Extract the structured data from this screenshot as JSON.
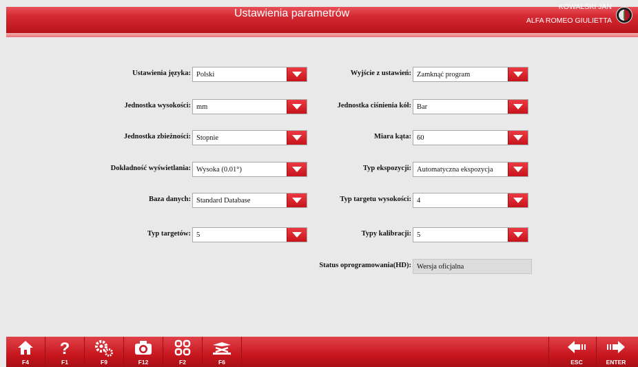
{
  "header": {
    "title": "Ustawienia parametrów",
    "user": "KOWALSKI JAN",
    "vehicle": "ALFA ROMEO GIULIETTA",
    "logo_icon": "alfa-romeo-logo-icon"
  },
  "left_settings": [
    {
      "label": "Ustawienia języka:",
      "value": "Polski"
    },
    {
      "label": "Jednostka wysokości:",
      "value": "mm"
    },
    {
      "label": "Jednostka zbieżności:",
      "value": "Stopnie"
    },
    {
      "label": "Dokładność wyświetlania:",
      "value": "Wysoka (0.01°)"
    },
    {
      "label": "Baza danych:",
      "value": "Standard Database"
    },
    {
      "label": "Typ targetów:",
      "value": "5"
    }
  ],
  "right_settings": [
    {
      "label": "Wyjście z ustawień:",
      "value": "Zamknąć program"
    },
    {
      "label": "Jednostka ciśnienia kół:",
      "value": "Bar"
    },
    {
      "label": "Miara kąta:",
      "value": "60"
    },
    {
      "label": "Typ ekspozycji:",
      "value": "Automatyczna ekspozycja"
    },
    {
      "label": "Typ targetu wysokości:",
      "value": "4"
    },
    {
      "label": "Typy kalibracji:",
      "value": "5"
    }
  ],
  "status": {
    "label": "Status oprogramowania(HD):",
    "value": "Wersja oficjalna"
  },
  "footer": {
    "keys": [
      {
        "label": "F4",
        "icon": "home-icon"
      },
      {
        "label": "F1",
        "icon": "help-icon"
      },
      {
        "label": "F9",
        "icon": "gears-icon"
      },
      {
        "label": "F12",
        "icon": "camera-icon"
      },
      {
        "label": "F2",
        "icon": "grid-icon"
      },
      {
        "label": "F6",
        "icon": "lift-icon"
      },
      {
        "label": "ESC",
        "icon": "back-arrow-icon"
      },
      {
        "label": "ENTER",
        "icon": "forward-arrow-icon"
      }
    ]
  },
  "colors": {
    "accent_red": "#d62a33",
    "background": "#e9e9e9"
  }
}
